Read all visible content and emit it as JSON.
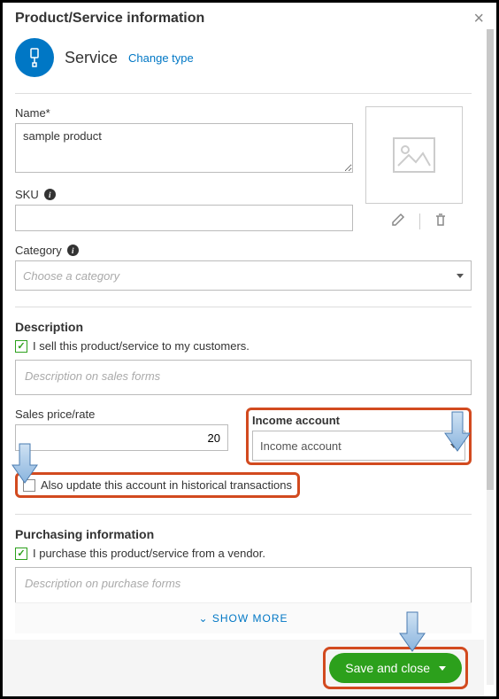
{
  "header": {
    "title": "Product/Service information"
  },
  "type": {
    "name": "Service",
    "change_label": "Change type"
  },
  "name": {
    "label": "Name*",
    "value": "sample product"
  },
  "sku": {
    "label": "SKU",
    "value": ""
  },
  "image_actions": {
    "edit": "edit-icon",
    "delete": "trash-icon"
  },
  "category": {
    "label": "Category",
    "placeholder": "Choose a category"
  },
  "description": {
    "heading": "Description",
    "sell_checkbox_label": "I sell this product/service to my customers.",
    "sell_checked": true,
    "placeholder": "Description on sales forms"
  },
  "sales_price": {
    "label": "Sales price/rate",
    "value": "20"
  },
  "income_account": {
    "label": "Income account",
    "placeholder": "Income account"
  },
  "historical": {
    "checked": false,
    "label": "Also update this account in historical transactions"
  },
  "purchasing": {
    "heading": "Purchasing information",
    "checkbox_label": "I purchase this product/service from a vendor.",
    "checked": true,
    "placeholder": "Description on purchase forms"
  },
  "show_more": "SHOW MORE",
  "footer": {
    "save_label": "Save and close"
  }
}
